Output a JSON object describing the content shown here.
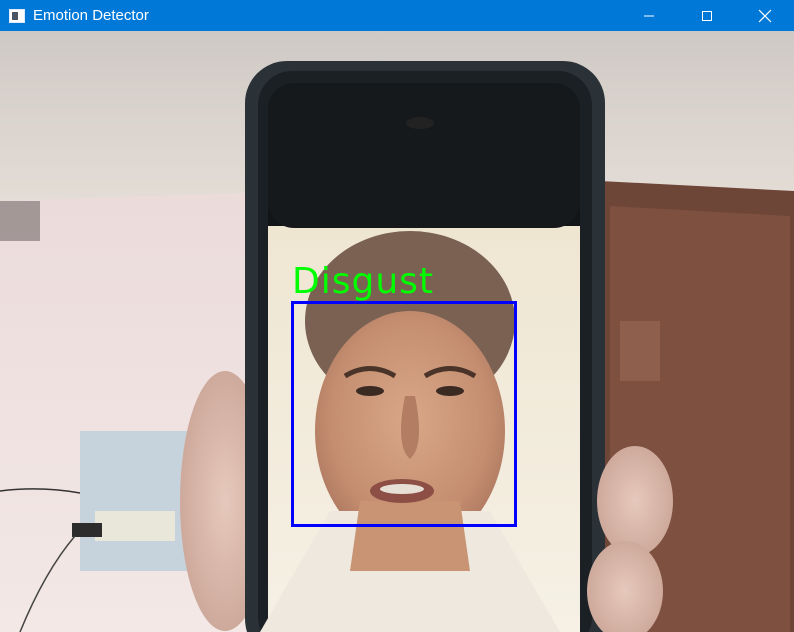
{
  "window": {
    "title": "Emotion Detector",
    "icon": "app-window-icon",
    "controls": {
      "minimize_icon": "minimize-icon",
      "maximize_icon": "maximize-icon",
      "close_icon": "close-icon"
    }
  },
  "detection": {
    "emotion": "Disgust"
  },
  "colors": {
    "titlebar": "#0078d7",
    "face_box": "#0000ff",
    "label": "#00ff00"
  }
}
